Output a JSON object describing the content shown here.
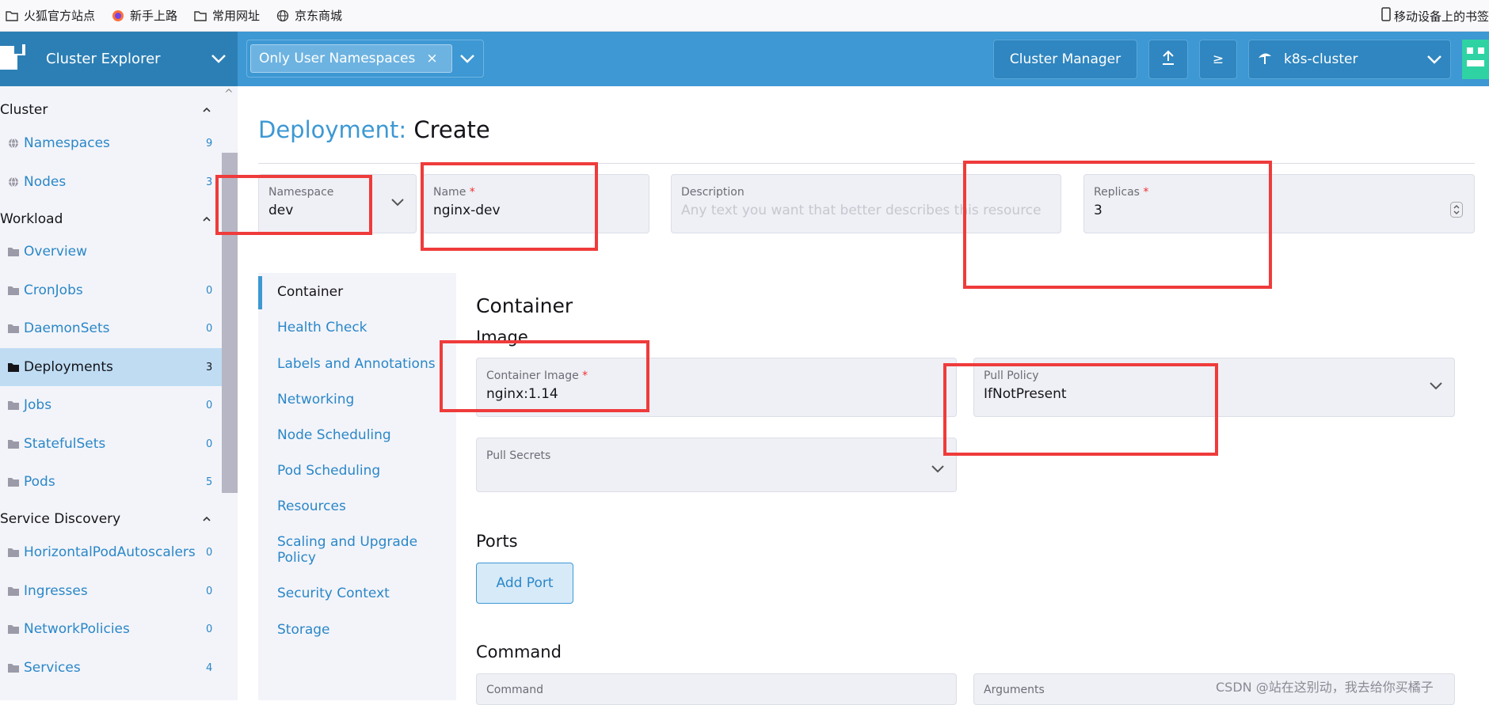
{
  "bookmarks": {
    "items": [
      {
        "icon": "folder-icon",
        "label": "火狐官方站点"
      },
      {
        "icon": "firefox-icon",
        "label": "新手上路"
      },
      {
        "icon": "folder-icon",
        "label": "常用网址"
      },
      {
        "icon": "globe-icon",
        "label": "京东商城"
      }
    ],
    "mobile_label": "移动设备上的书签"
  },
  "header": {
    "brand_title": "Cluster Explorer",
    "namespace_filter": "Only User Namespaces",
    "chip_remove": "×",
    "cluster_manager_label": "Cluster Manager",
    "upload_icon": "upload-icon",
    "shell_glyph": "≥",
    "cluster_name": "k8s-cluster",
    "colors": {
      "header": "#3d98d3",
      "brand": "#2c7fb5",
      "avatar": "#2fd3a3"
    }
  },
  "sidebar": {
    "groups": [
      {
        "label": "Cluster",
        "items": [
          {
            "label": "Namespaces",
            "count": "9",
            "icon": "globe-icon"
          },
          {
            "label": "Nodes",
            "count": "3",
            "icon": "globe-icon"
          }
        ]
      },
      {
        "label": "Workload",
        "items": [
          {
            "label": "Overview",
            "count": "",
            "icon": "folder-icon"
          },
          {
            "label": "CronJobs",
            "count": "0",
            "icon": "folder-icon"
          },
          {
            "label": "DaemonSets",
            "count": "0",
            "icon": "folder-icon"
          },
          {
            "label": "Deployments",
            "count": "3",
            "icon": "folder-icon",
            "active": true
          },
          {
            "label": "Jobs",
            "count": "0",
            "icon": "folder-icon"
          },
          {
            "label": "StatefulSets",
            "count": "0",
            "icon": "folder-icon"
          },
          {
            "label": "Pods",
            "count": "5",
            "icon": "folder-icon"
          }
        ]
      },
      {
        "label": "Service Discovery",
        "items": [
          {
            "label": "HorizontalPodAutoscalers",
            "count": "0",
            "icon": "folder-icon"
          },
          {
            "label": "Ingresses",
            "count": "0",
            "icon": "folder-icon"
          },
          {
            "label": "NetworkPolicies",
            "count": "0",
            "icon": "folder-icon"
          },
          {
            "label": "Services",
            "count": "4",
            "icon": "folder-icon"
          }
        ]
      }
    ]
  },
  "page": {
    "title_kind": "Deployment:",
    "title_action": "Create"
  },
  "form": {
    "namespace": {
      "label": "Namespace",
      "value": "dev"
    },
    "name": {
      "label": "Name",
      "required": "*",
      "value": "nginx-dev"
    },
    "description": {
      "label": "Description",
      "placeholder": "Any text you want that better describes this resource"
    },
    "replicas": {
      "label": "Replicas",
      "required": "*",
      "value": "3"
    }
  },
  "tabs": [
    {
      "label": "Container",
      "active": true
    },
    {
      "label": "Health Check"
    },
    {
      "label": "Labels and Annotations"
    },
    {
      "label": "Networking"
    },
    {
      "label": "Node Scheduling"
    },
    {
      "label": "Pod Scheduling"
    },
    {
      "label": "Resources"
    },
    {
      "label": "Scaling and Upgrade Policy"
    },
    {
      "label": "Security Context"
    },
    {
      "label": "Storage"
    }
  ],
  "container": {
    "heading": "Container",
    "image_heading": "Image",
    "container_image": {
      "label": "Container Image",
      "required": "*",
      "value": "nginx:1.14"
    },
    "pull_policy": {
      "label": "Pull Policy",
      "value": "IfNotPresent"
    },
    "pull_secrets": {
      "label": "Pull Secrets"
    },
    "ports_heading": "Ports",
    "add_port_label": "Add Port",
    "command_heading": "Command",
    "command": {
      "label": "Command"
    },
    "arguments": {
      "label": "Arguments"
    }
  },
  "watermark": "CSDN @站在这别动，我去给你买橘子"
}
